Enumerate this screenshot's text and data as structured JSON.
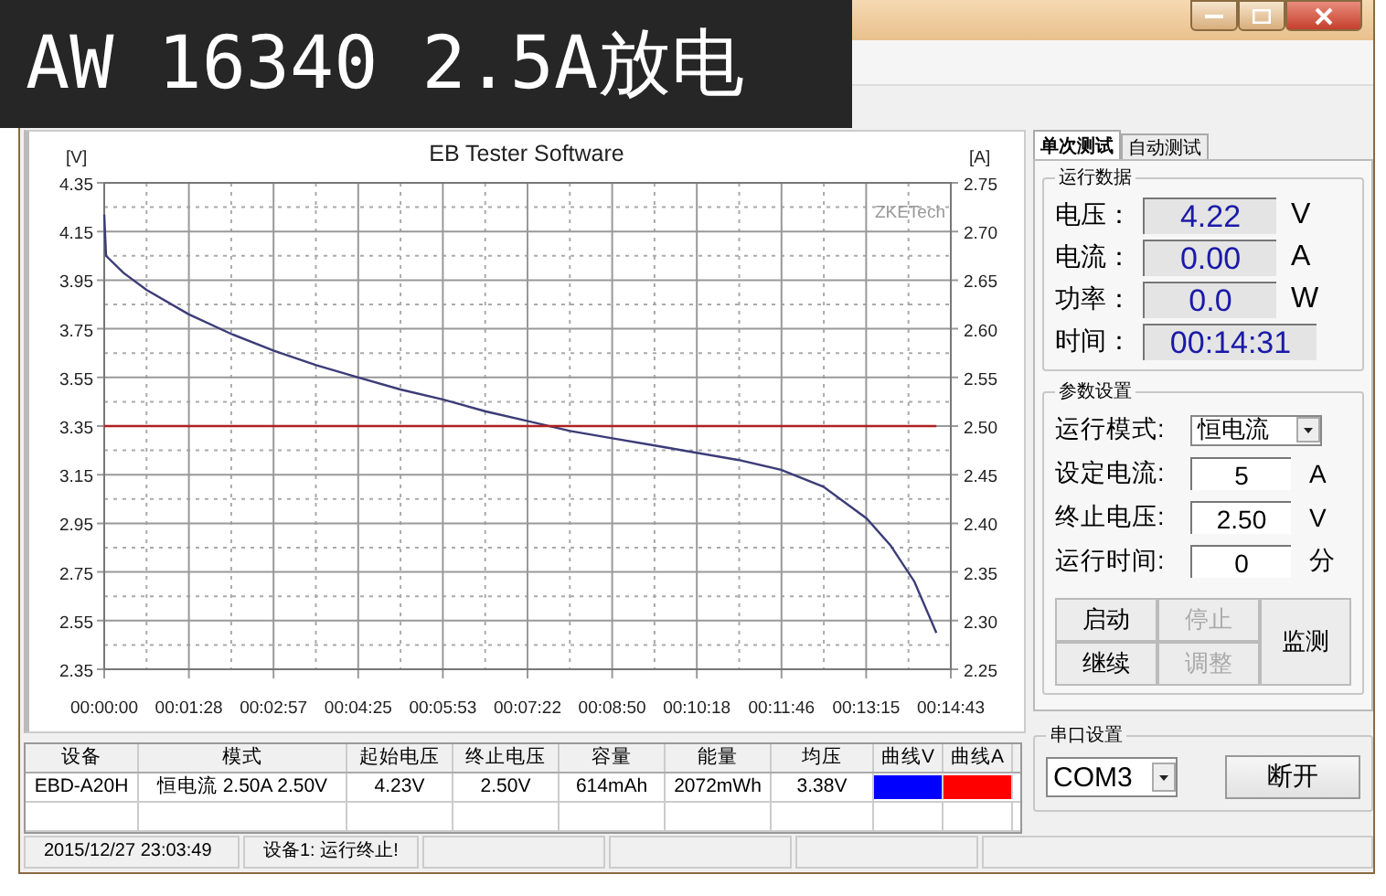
{
  "caption": "AW 16340 2.5A放电",
  "chart": {
    "left_unit": "[V]",
    "right_unit": "[A]",
    "brand": "ZKETech",
    "right_labels": [
      "2.75",
      "2.70",
      "2.65",
      "2.60",
      "2.55",
      "2.50",
      "2.45",
      "2.40",
      "2.35",
      "2.30",
      "2.25"
    ],
    "chart_data": {
      "type": "line",
      "title": "EB Tester Software",
      "grid": true,
      "x": [
        0,
        2,
        20,
        44,
        88,
        132,
        177,
        221,
        265,
        309,
        353,
        398,
        442,
        486,
        530,
        574,
        618,
        662,
        706,
        750,
        795,
        820,
        845,
        868
      ],
      "series": [
        {
          "color": "#3c3c78",
          "values": [
            4.22,
            4.05,
            3.98,
            3.91,
            3.81,
            3.73,
            3.66,
            3.6,
            3.55,
            3.5,
            3.46,
            3.41,
            3.37,
            3.33,
            3.3,
            3.27,
            3.24,
            3.21,
            3.17,
            3.1,
            2.97,
            2.86,
            2.71,
            2.5
          ]
        },
        {
          "color": "#b02020",
          "values": [
            3.35,
            3.35,
            3.35,
            3.35,
            3.35,
            3.35,
            3.35,
            3.35,
            3.35,
            3.35,
            3.35,
            3.35,
            3.35,
            3.35,
            3.35,
            3.35,
            3.35,
            3.35,
            3.35,
            3.35,
            3.35,
            3.35,
            3.35,
            3.35
          ]
        }
      ],
      "xlim": [
        0,
        883
      ],
      "ylim": [
        2.35,
        4.35
      ],
      "xticks": [
        {
          "value": 0,
          "label": "00:00:00"
        },
        {
          "value": 88.3,
          "label": "00:01:28"
        },
        {
          "value": 176.6,
          "label": "00:02:57"
        },
        {
          "value": 264.9,
          "label": "00:04:25"
        },
        {
          "value": 353.2,
          "label": "00:05:53"
        },
        {
          "value": 441.5,
          "label": "00:07:22"
        },
        {
          "value": 529.8,
          "label": "00:08:50"
        },
        {
          "value": 618.1,
          "label": "00:10:18"
        },
        {
          "value": 706.4,
          "label": "00:11:46"
        },
        {
          "value": 794.7,
          "label": "00:13:15"
        },
        {
          "value": 883,
          "label": "00:14:43"
        }
      ],
      "yticks": [
        {
          "value": 2.35,
          "label": "2.35"
        },
        {
          "value": 2.55,
          "label": "2.55"
        },
        {
          "value": 2.75,
          "label": "2.75"
        },
        {
          "value": 2.95,
          "label": "2.95"
        },
        {
          "value": 3.15,
          "label": "3.15"
        },
        {
          "value": 3.35,
          "label": "3.35"
        },
        {
          "value": 3.55,
          "label": "3.55"
        },
        {
          "value": 3.75,
          "label": "3.75"
        },
        {
          "value": 3.95,
          "label": "3.95"
        },
        {
          "value": 4.15,
          "label": "4.15"
        },
        {
          "value": 4.35,
          "label": "4.35"
        }
      ]
    }
  },
  "tabs": [
    {
      "label": "单次测试",
      "selected": true
    },
    {
      "label": "自动测试",
      "selected": false
    }
  ],
  "run_data": {
    "title": "运行数据",
    "rows": [
      {
        "label": "电压：",
        "value": "4.22",
        "unit": "V"
      },
      {
        "label": "电流：",
        "value": "0.00",
        "unit": "A"
      },
      {
        "label": "功率：",
        "value": "0.0",
        "unit": "W"
      },
      {
        "label": "时间：",
        "value": "00:14:31"
      }
    ]
  },
  "params": {
    "title": "参数设置",
    "rows": [
      {
        "kind": "select",
        "label": "运行模式:",
        "value": "恒电流"
      },
      {
        "kind": "input",
        "label": "设定电流:",
        "value": "5",
        "unit": "A"
      },
      {
        "kind": "input",
        "label": "终止电压:",
        "value": "2.50",
        "unit": "V"
      },
      {
        "kind": "input",
        "label": "运行时间:",
        "value": "0",
        "unit": "分"
      }
    ],
    "buttons": [
      {
        "label": "启动",
        "disabled": false
      },
      {
        "label": "停止",
        "disabled": true
      },
      {
        "label": "继续",
        "disabled": false
      },
      {
        "label": "调整",
        "disabled": true
      }
    ],
    "monitor": "监测"
  },
  "serial": {
    "title": "串口设置",
    "port": "COM3",
    "button": "断开"
  },
  "table": {
    "columns": [
      "设备",
      "模式",
      "起始电压",
      "终止电压",
      "容量",
      "能量",
      "均压",
      "曲线V",
      "曲线A"
    ],
    "rows": [
      {
        "cells": [
          {
            "kind": "text",
            "text": "EBD-A20H"
          },
          {
            "kind": "text",
            "text": "恒电流  2.50A  2.50V"
          },
          {
            "kind": "text",
            "text": "4.23V"
          },
          {
            "kind": "text",
            "text": "2.50V"
          },
          {
            "kind": "text",
            "text": "614mAh"
          },
          {
            "kind": "text",
            "text": "2072mWh"
          },
          {
            "kind": "text",
            "text": "3.38V"
          },
          {
            "kind": "swatch",
            "color": "#0000ff"
          },
          {
            "kind": "swatch",
            "color": "#ff0000"
          }
        ]
      }
    ]
  },
  "status_bar": [
    "2015/12/27 23:03:49",
    "设备1: 运行终止!"
  ]
}
